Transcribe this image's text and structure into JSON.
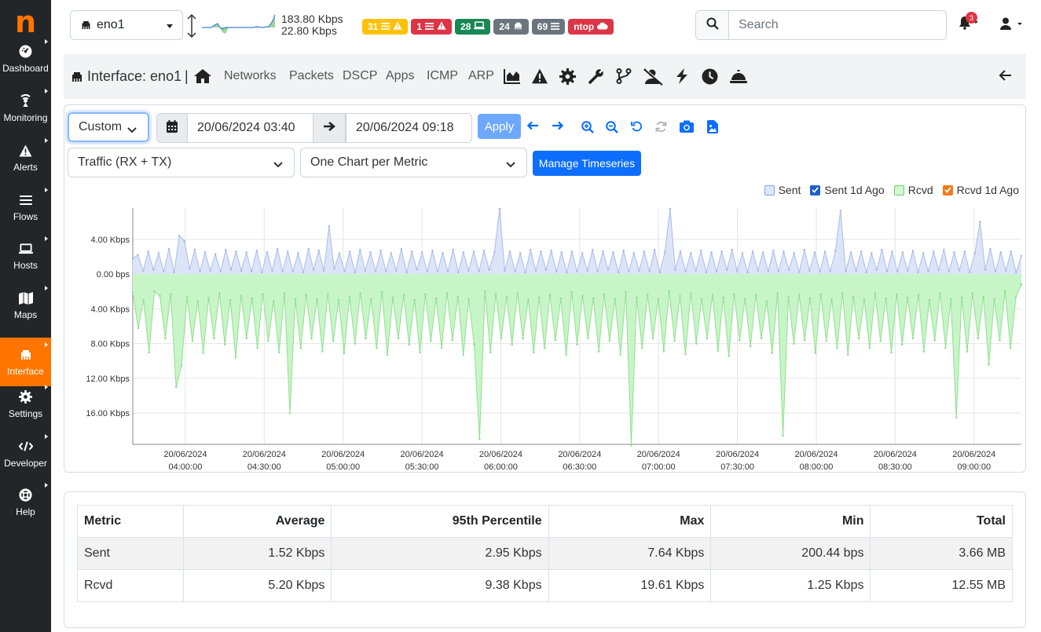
{
  "sidebar": {
    "logo": "n",
    "items": [
      {
        "label": "Dashboard",
        "icon": "gauge-icon"
      },
      {
        "label": "Monitoring",
        "icon": "monitoring-icon"
      },
      {
        "label": "Alerts",
        "icon": "alert-triangle-icon"
      },
      {
        "label": "Flows",
        "icon": "bars-icon"
      },
      {
        "label": "Hosts",
        "icon": "laptop-icon"
      },
      {
        "label": "Maps",
        "icon": "map-icon"
      },
      {
        "label": "Interface",
        "icon": "ethernet-icon",
        "active": true
      },
      {
        "label": "Settings",
        "icon": "gear-icon"
      },
      {
        "label": "Developer",
        "icon": "code-icon"
      },
      {
        "label": "Help",
        "icon": "lifering-icon"
      }
    ]
  },
  "topbar": {
    "interface": "eno1",
    "throughput_up": "183.80 Kbps",
    "throughput_down": "22.80 Kbps",
    "badges": [
      {
        "text": "31",
        "color": "#ffc107",
        "icons": "list-icon alert-icon"
      },
      {
        "text": "1",
        "color": "#dc3545",
        "icons": "list-icon alert-icon"
      },
      {
        "text": "28",
        "color": "#198754",
        "icons": "laptop-icon"
      },
      {
        "text": "24",
        "color": "#6c757d",
        "icons": "ethernet-icon"
      },
      {
        "text": "69",
        "color": "#6c757d",
        "icons": "list-icon"
      },
      {
        "text": "ntop",
        "color": "#dc3545",
        "icons": "cloud-icon"
      }
    ],
    "search_placeholder": "Search",
    "notifications": "3"
  },
  "subnav": {
    "title": "Interface: eno1",
    "separator": "|",
    "links": [
      "Networks",
      "Packets",
      "DSCP",
      "Apps",
      "ICMP",
      "ARP"
    ]
  },
  "controls": {
    "range": "Custom",
    "date_from": "20/06/2024 03:40",
    "date_to": "20/06/2024 09:18",
    "apply": "Apply",
    "metric": "Traffic (RX + TX)",
    "layout": "One Chart per Metric",
    "manage": "Manage Timeseries"
  },
  "colors": {
    "accent": "#ff7500",
    "primary": "#0d6efd",
    "sent_fill": "#dce5f8",
    "sent_line": "#a9bde9",
    "rcvd_fill": "#c8f5c8",
    "rcvd_line": "#8fe08f"
  },
  "chart_data": {
    "type": "area",
    "legend": [
      {
        "name": "Sent",
        "checked": false,
        "color": "#a9bde9"
      },
      {
        "name": "Sent 1d Ago",
        "checked": true,
        "color": "#0d6efd"
      },
      {
        "name": "Rcvd",
        "checked": false,
        "color": "#8fe08f"
      },
      {
        "name": "Rcvd 1d Ago",
        "checked": true,
        "color": "#fd7e14"
      }
    ],
    "legend_position": "top-right",
    "y_tick_labels": [
      "4.00 Kbps",
      "0.00 bps",
      "4.00 Kbps",
      "8.00 Kbps",
      "12.00 Kbps",
      "16.00 Kbps"
    ],
    "y_tick_values": [
      4,
      0,
      -4,
      -8,
      -12,
      -16
    ],
    "ylim": [
      -19.6,
      7.6
    ],
    "x_ticks": [
      {
        "date": "20/06/2024",
        "time": "04:00:00",
        "min": 20
      },
      {
        "date": "20/06/2024",
        "time": "04:30:00",
        "min": 50
      },
      {
        "date": "20/06/2024",
        "time": "05:00:00",
        "min": 80
      },
      {
        "date": "20/06/2024",
        "time": "05:30:00",
        "min": 110
      },
      {
        "date": "20/06/2024",
        "time": "06:00:00",
        "min": 140
      },
      {
        "date": "20/06/2024",
        "time": "06:30:00",
        "min": 170
      },
      {
        "date": "20/06/2024",
        "time": "07:00:00",
        "min": 200
      },
      {
        "date": "20/06/2024",
        "time": "07:30:00",
        "min": 230
      },
      {
        "date": "20/06/2024",
        "time": "08:00:00",
        "min": 260
      },
      {
        "date": "20/06/2024",
        "time": "08:30:00",
        "min": 290
      },
      {
        "date": "20/06/2024",
        "time": "09:00:00",
        "min": 320
      }
    ],
    "xlim_minutes": [
      0,
      338
    ],
    "grid": true,
    "series": [
      {
        "name": "Sent",
        "values": [
          1.8,
          2.2,
          0.4,
          2.6,
          0.5,
          2.4,
          0.3,
          2.9,
          0.2,
          4.4,
          3.8,
          0.6,
          2.8,
          0.3,
          2.5,
          0.4,
          2.3,
          0.3,
          2.8,
          0.5,
          2.6,
          0.4,
          2.5,
          0.3,
          2.7,
          0.2,
          2.5,
          0.4,
          2.9,
          0.3,
          2.6,
          0.3,
          2.4,
          0.2,
          2.9,
          0.5,
          2.7,
          0.4,
          5.5,
          0.6,
          2.4,
          0.3,
          2.6,
          0.2,
          2.8,
          0.4,
          2.5,
          0.3,
          2.7,
          0.3,
          2.4,
          0.4,
          2.9,
          0.2,
          2.6,
          0.5,
          2.5,
          0.3,
          2.7,
          0.3,
          2.4,
          0.3,
          2.8,
          0.2,
          2.5,
          0.4,
          2.6,
          0.3,
          2.7,
          0.5,
          2.5,
          7.5,
          0.4,
          2.6,
          0.3,
          2.4,
          0.2,
          2.8,
          0.4,
          2.6,
          0.5,
          2.7,
          0.3,
          2.5,
          0.2,
          2.6,
          0.3,
          2.4,
          0.4,
          2.8,
          0.3,
          2.6,
          0.5,
          2.5,
          0.2,
          2.7,
          0.3,
          2.4,
          0.4,
          2.6,
          0.3,
          2.8,
          0.2,
          2.5,
          7.5,
          0.5,
          2.6,
          0.3,
          2.4,
          0.4,
          2.7,
          0.2,
          2.5,
          0.3,
          2.6,
          0.5,
          2.8,
          0.3,
          2.4,
          0.2,
          2.6,
          0.4,
          2.5,
          0.3,
          2.7,
          0.3,
          2.6,
          0.5,
          2.4,
          0.2,
          2.8,
          0.4,
          2.5,
          0.3,
          2.6,
          0.3,
          2.7,
          7.3,
          0.3,
          2.5,
          0.4,
          2.6,
          0.2,
          2.4,
          0.5,
          2.8,
          0.3,
          2.6,
          0.3,
          2.5,
          0.4,
          2.7,
          0.2,
          2.4,
          0.3,
          2.6,
          0.5,
          2.8,
          0.3,
          2.5,
          0.4,
          2.6,
          0.2,
          2.4,
          6.0,
          0.5,
          2.9,
          0.3,
          2.5,
          0.4,
          2.6,
          0.2,
          2.1
        ]
      },
      {
        "name": "Rcvd",
        "values": [
          -2.1,
          -6.2,
          -3.0,
          -9.0,
          -2.0,
          -2.5,
          -7.4,
          -2.3,
          -13.0,
          -10.5,
          -2.6,
          -7.7,
          -3.1,
          -9.1,
          -2.7,
          -7.4,
          -2.2,
          -8.1,
          -3.0,
          -9.6,
          -2.5,
          -7.4,
          -2.8,
          -8.5,
          -2.3,
          -7.7,
          -3.1,
          -9.0,
          -2.2,
          -16.0,
          -2.9,
          -8.5,
          -2.4,
          -7.4,
          -2.9,
          -8.9,
          -2.3,
          -7.7,
          -3.0,
          -9.1,
          -2.6,
          -8.0,
          -2.2,
          -7.4,
          -2.9,
          -8.5,
          -2.1,
          -9.3,
          -2.7,
          -7.4,
          -2.4,
          -8.1,
          -3.0,
          -9.0,
          -2.3,
          -7.7,
          -2.8,
          -8.5,
          -2.2,
          -7.6,
          -2.6,
          -9.3,
          -2.9,
          -8.1,
          -19.0,
          -2.0,
          -9.0,
          -2.3,
          -7.4,
          -2.6,
          -8.1,
          -2.2,
          -7.4,
          -2.9,
          -9.0,
          -2.7,
          -8.5,
          -2.4,
          -7.6,
          -2.8,
          -9.3,
          -2.1,
          -8.1,
          -2.5,
          -7.4,
          -2.8,
          -8.9,
          -2.3,
          -7.7,
          -2.9,
          -9.3,
          -2.1,
          -19.7,
          -2.7,
          -8.5,
          -2.4,
          -7.4,
          -2.9,
          -8.9,
          -2.0,
          -7.7,
          -2.5,
          -9.2,
          -2.2,
          -8.0,
          -2.9,
          -7.4,
          -2.4,
          -8.8,
          -2.7,
          -9.4,
          -2.3,
          -7.6,
          -2.9,
          -8.3,
          -2.4,
          -7.4,
          -3.1,
          -9.1,
          -2.2,
          -18.6,
          -2.6,
          -8.0,
          -2.4,
          -7.6,
          -2.8,
          -9.1,
          -2.3,
          -7.7,
          -2.9,
          -8.5,
          -2.2,
          -9.3,
          -2.6,
          -7.4,
          -2.9,
          -8.5,
          -2.2,
          -7.7,
          -2.8,
          -9.0,
          -2.3,
          -8.1,
          -2.7,
          -7.4,
          -2.4,
          -8.9,
          -3.0,
          -7.6,
          -2.2,
          -8.5,
          -2.9,
          -16.5,
          -2.7,
          -8.9,
          -2.2,
          -7.4,
          -2.6,
          -10.4,
          -2.9,
          -7.6,
          -2.0,
          -8.5,
          -2.6,
          -1.2
        ]
      }
    ]
  },
  "stats": {
    "headers": [
      "Metric",
      "Average",
      "95th Percentile",
      "Max",
      "Min",
      "Total"
    ],
    "rows": [
      [
        "Sent",
        "1.52 Kbps",
        "2.95 Kbps",
        "7.64 Kbps",
        "200.44 bps",
        "3.66 MB"
      ],
      [
        "Rcvd",
        "5.20 Kbps",
        "9.38 Kbps",
        "19.61 Kbps",
        "1.25 Kbps",
        "12.55 MB"
      ]
    ]
  }
}
